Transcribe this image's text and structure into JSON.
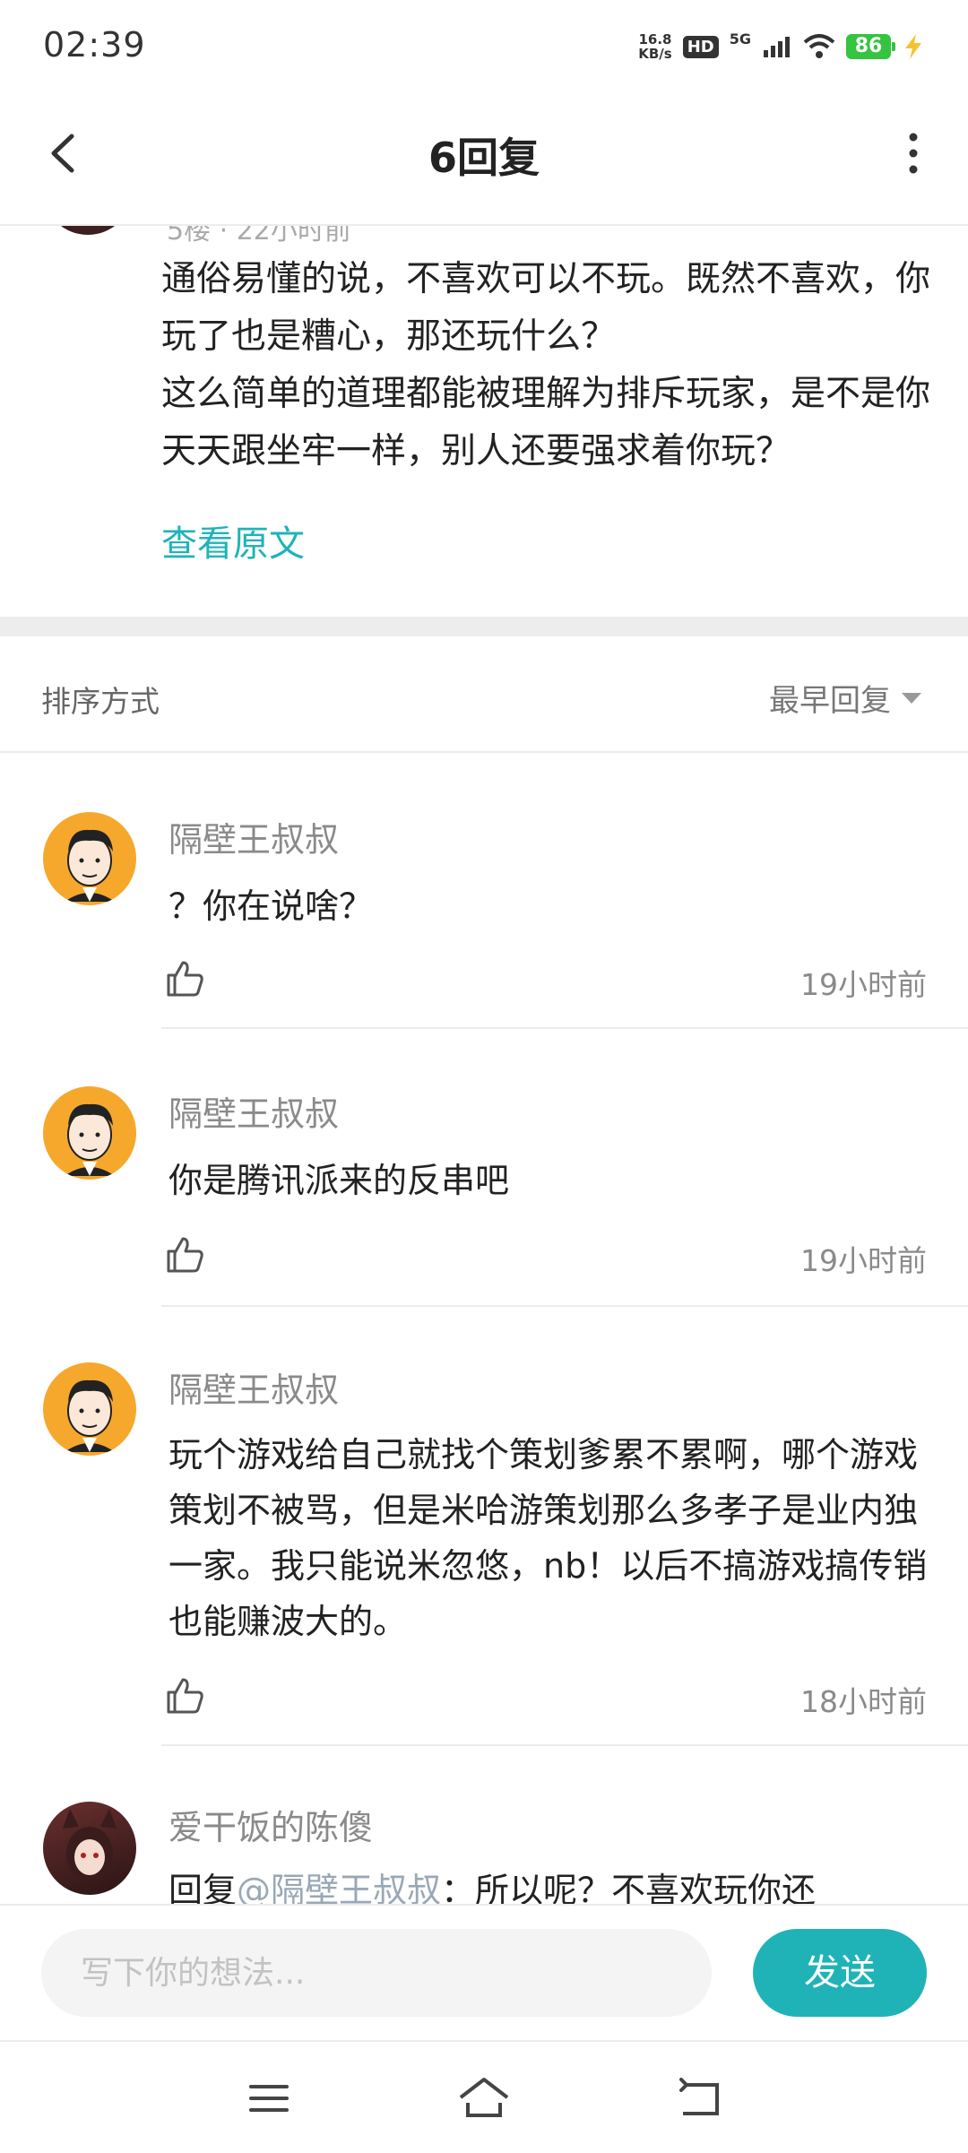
{
  "status_bar": {
    "time": "02:39",
    "net_speed_value": "16.8",
    "net_speed_unit": "KB/s",
    "hd": "HD",
    "network": "5G",
    "battery": "86"
  },
  "header": {
    "title": "6回复"
  },
  "post": {
    "meta": "5楼 · 22小时前",
    "lines": [
      "通俗易懂的说，不喜欢可以不玩。既然不喜欢，你玩了也是糟心，那还玩什么？",
      "这么简单的道理都能被理解为排斥玩家，是不是你天天跟坐牢一样，别人还要强求着你玩？"
    ],
    "view_original": "查看原文"
  },
  "sort": {
    "label": "排序方式",
    "selected": "最早回复"
  },
  "comments": [
    {
      "name": "隔壁王叔叔",
      "text": "？你在说啥？",
      "time": "19小时前"
    },
    {
      "name": "隔壁王叔叔",
      "text": "你是腾讯派来的反串吧",
      "time": "19小时前"
    },
    {
      "name": "隔壁王叔叔",
      "text": "玩个游戏给自己就找个策划爹累不累啊，哪个游戏策划不被骂，但是米哈游策划那么多孝子是业内独一家。我只能说米忽悠，nb！以后不搞游戏搞传销也能赚波大的。",
      "time": "18小时前"
    },
    {
      "name": "爱干饭的陈傻",
      "reply_prefix": "回复",
      "mention": "@隔壁王叔叔",
      "text": "：所以呢？不喜欢玩你还"
    }
  ],
  "input": {
    "placeholder": "写下你的想法...",
    "send": "发送"
  },
  "colors": {
    "accent": "#1fb3b8",
    "battery": "#35c43f",
    "avatar_orange": "#f6a82c"
  },
  "icons": [
    "back-icon",
    "more-icon",
    "like-icon",
    "caret-down-icon",
    "menu-icon",
    "home-icon",
    "back-nav-icon"
  ]
}
